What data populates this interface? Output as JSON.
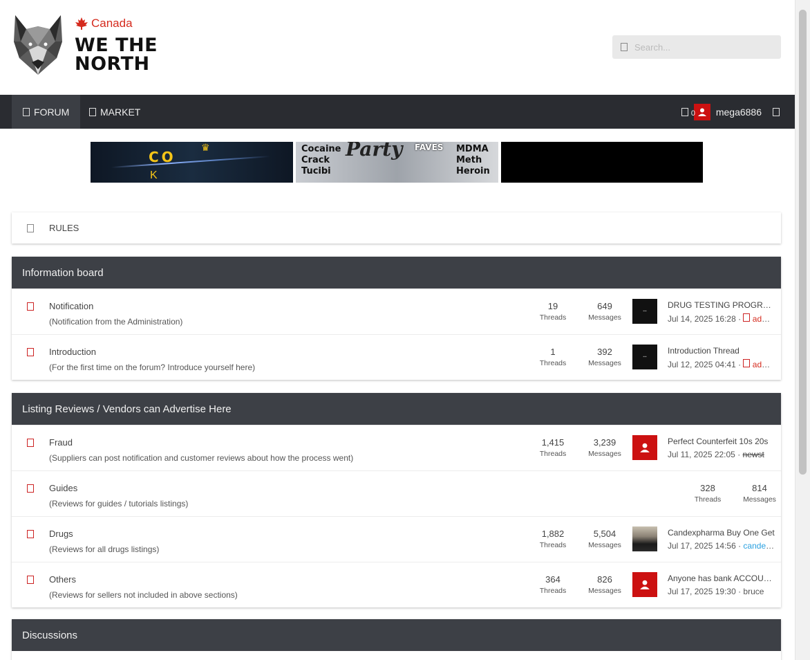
{
  "header": {
    "brand_country": "Canada",
    "brand_line1": "WE THE",
    "brand_line2": "NORTH",
    "search_placeholder": "Search..."
  },
  "nav": {
    "forum_label": "FORUM",
    "market_label": "MARKET",
    "alert_count": "0",
    "username": "mega6886"
  },
  "banners": {
    "banner1": {
      "text": "CO",
      "subtext": "K"
    },
    "banner2": {
      "left_lines": [
        "Cocaine",
        "Crack",
        "Tucibi"
      ],
      "mid": "Party",
      "faves": "FAVES",
      "right_lines": [
        "MDMA",
        "Meth",
        "Heroin"
      ]
    }
  },
  "rules_label": "RULES",
  "categories": [
    {
      "title": "Information board",
      "nodes": [
        {
          "title": "Notification",
          "desc": "(Notification from the Administration)",
          "threads": "19",
          "messages": "649",
          "latest_title": "DRUG TESTING PROGRAM",
          "latest_date": "Jul 14, 2025 16:28 ·",
          "latest_user": "admin",
          "avatar": "dark"
        },
        {
          "title": "Introduction",
          "desc": "(For the first time on the forum? Introduce yourself here)",
          "threads": "1",
          "messages": "392",
          "latest_title": "Introduction Thread",
          "latest_date": "Jul 12, 2025 04:41 ·",
          "latest_user": "admin",
          "avatar": "dark"
        }
      ]
    },
    {
      "title": "Listing Reviews / Vendors can Advertise Here",
      "nodes": [
        {
          "title": "Fraud",
          "desc": "(Suppliers can post notification and customer reviews about how the process went)",
          "threads": "1,415",
          "messages": "3,239",
          "latest_title": "Perfect Counterfeit 10s 20s",
          "latest_date": "Jul 11, 2025 22:05 ·",
          "latest_user": "newst",
          "avatar": "red"
        },
        {
          "title": "Guides",
          "desc": "(Reviews for guides / tutorials listings)",
          "threads": "328",
          "messages": "814"
        },
        {
          "title": "Drugs",
          "desc": "(Reviews for all drugs listings)",
          "threads": "1,882",
          "messages": "5,504",
          "latest_title": "Candexpharma Buy One Get",
          "latest_date": "Jul 17, 2025 14:56 ·",
          "latest_user": "candexpharma",
          "avatar": "photo"
        },
        {
          "title": "Others",
          "desc": "(Reviews for sellers not included in above sections)",
          "threads": "364",
          "messages": "826",
          "latest_title": "Anyone has bank ACCOUNTS",
          "latest_date": "Jul 17, 2025 19:30 ·",
          "latest_user": "bruce",
          "avatar": "red"
        }
      ]
    },
    {
      "title": "Discussions"
    }
  ],
  "labels": {
    "threads": "Threads",
    "messages": "Messages"
  },
  "colors": {
    "nav_bg": "#2a2c31",
    "category_header_bg": "#3d4046",
    "accent_red": "#d52b1e",
    "link_blue": "#2aa0e0"
  }
}
